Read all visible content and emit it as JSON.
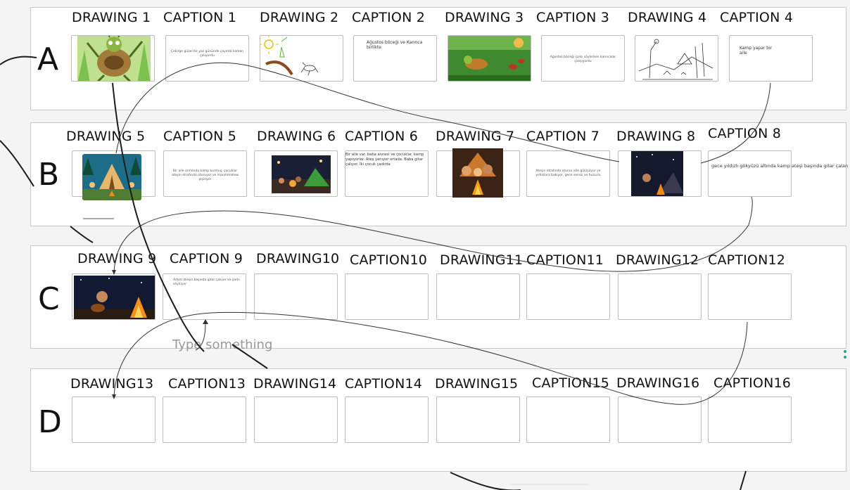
{
  "rows": [
    {
      "label": "A",
      "cells": [
        {
          "title": "DRAWING 1",
          "kind": "image",
          "icon": "grasshopper-illustration"
        },
        {
          "title": "CAPTION 1",
          "kind": "text",
          "text": "Çekirge güzel bir yaz gününde çayırda keman çalıyordu"
        },
        {
          "title": "DRAWING 2",
          "kind": "image",
          "icon": "sketch-grasshopper-ant"
        },
        {
          "title": "CAPTION 2",
          "kind": "text",
          "text": "Ağustos böceği ve Karınca birlikte"
        },
        {
          "title": "DRAWING 3",
          "kind": "image",
          "icon": "grasshopper-ants-scene"
        },
        {
          "title": "CAPTION 3",
          "kind": "text",
          "text": "Ağustos böceği şarkı söylerken karıncalar çalışıyordu"
        },
        {
          "title": "DRAWING 4",
          "kind": "image",
          "icon": "camping-sketch"
        },
        {
          "title": "CAPTION 4",
          "kind": "text",
          "text": "Kamp yapar bir aile"
        }
      ]
    },
    {
      "label": "B",
      "cells": [
        {
          "title": "DRAWING 5",
          "kind": "image",
          "icon": "family-tent-cartoon"
        },
        {
          "title": "CAPTION 5",
          "kind": "text",
          "text": "Bir aile ormanda kamp kurmuş, çocuklar ateşin etrafında oturuyor ve marshmallow pişiriyor"
        },
        {
          "title": "DRAWING 6",
          "kind": "image",
          "icon": "night-camp-tent"
        },
        {
          "title": "CAPTION 6",
          "kind": "text",
          "text": "Bir aile var. baba annesi ve çocuklar. kamp yapıyorlar. Ateş yanıyor ortada. Baba gitar çalıyor. İki çocuk çadırda"
        },
        {
          "title": "DRAWING 7",
          "kind": "image",
          "icon": "family-campfire"
        },
        {
          "title": "CAPTION 7",
          "kind": "text",
          "text": "Ateşin etrafında oturan aile gülüşüyor ve yıldızlara bakıyor, gece sessiz ve huzurlu"
        },
        {
          "title": "DRAWING 8",
          "kind": "image",
          "icon": "starry-night-campfire"
        },
        {
          "title": "CAPTION 8",
          "kind": "text",
          "text": "gece yıldızlı gökyüzü altında kamp ateşi başında gitar çalan"
        }
      ]
    },
    {
      "label": "C",
      "cells": [
        {
          "title": "DRAWING 9",
          "kind": "image",
          "icon": "guitar-campfire"
        },
        {
          "title": "CAPTION 9",
          "kind": "text",
          "text": "Adam ateşin başında gitar çalıyor ve şarkı söylüyor"
        },
        {
          "title": "DRAWING10",
          "kind": "empty"
        },
        {
          "title": "CAPTION10",
          "kind": "empty"
        },
        {
          "title": "DRAWING11",
          "kind": "empty"
        },
        {
          "title": "CAPTION11",
          "kind": "empty"
        },
        {
          "title": "DRAWING12",
          "kind": "empty"
        },
        {
          "title": "CAPTION12",
          "kind": "empty"
        }
      ]
    },
    {
      "label": "D",
      "cells": [
        {
          "title": "DRAWING13",
          "kind": "empty"
        },
        {
          "title": "CAPTION13",
          "kind": "empty"
        },
        {
          "title": "DRAWING14",
          "kind": "empty"
        },
        {
          "title": "CAPTION14",
          "kind": "empty"
        },
        {
          "title": "DRAWING15",
          "kind": "empty"
        },
        {
          "title": "CAPTION15",
          "kind": "empty"
        },
        {
          "title": "DRAWING16",
          "kind": "empty"
        },
        {
          "title": "CAPTION16",
          "kind": "empty"
        }
      ]
    }
  ],
  "canvas": {
    "placeholder": "Type something",
    "connector_color": "#222222",
    "arrow_color": "#333333",
    "accent": "#2f9f8f"
  }
}
